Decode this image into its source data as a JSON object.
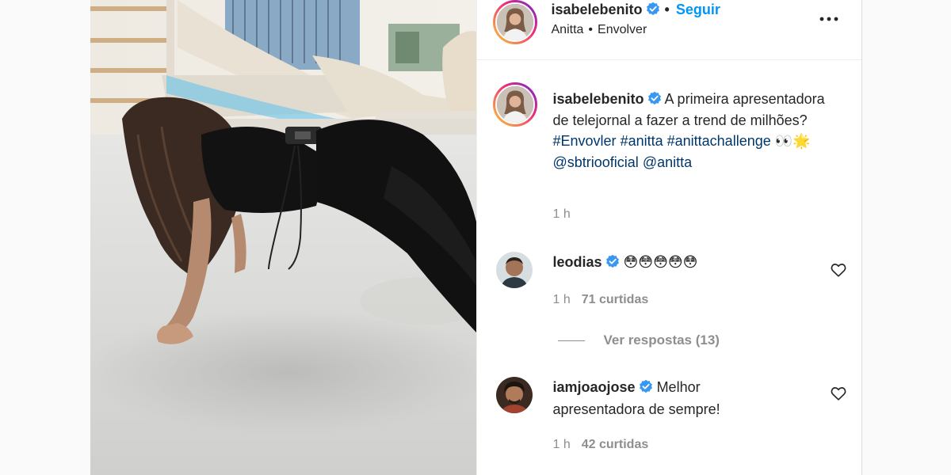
{
  "header": {
    "username": "isabelebenito",
    "dot": "•",
    "follow_label": "Seguir",
    "audio_artist": "Anitta",
    "audio_sep": "•",
    "audio_track": "Envolver"
  },
  "caption": {
    "username": "isabelebenito",
    "text_1": "A primeira apresentadora de telejornal a fazer a trend de milhões?",
    "tag_1": "#Envovler",
    "tag_2": "#anitta",
    "tag_3": "#anittachallenge",
    "emoji": "👀🌟",
    "mention_1": "@sbtriooficial",
    "mention_2": "@anitta",
    "time": "1 h"
  },
  "comments": [
    {
      "username": "leodias",
      "text": "😳😳😳😳😳",
      "time": "1 h",
      "likes": "71 curtidas",
      "replies": "Ver respostas (13)"
    },
    {
      "username": "iamjoaojose",
      "text_1": "Melhor",
      "text_2": "apresentadora de sempre!",
      "time": "1 h",
      "likes": "42 curtidas"
    }
  ],
  "icons": {
    "verified": "verified-badge-icon",
    "more": "more-options-icon",
    "like": "heart-outline-icon"
  },
  "colors": {
    "link": "#0095f6",
    "hashtag": "#00376b",
    "secondary": "#8e8e8e",
    "verified": "#3897f0"
  }
}
